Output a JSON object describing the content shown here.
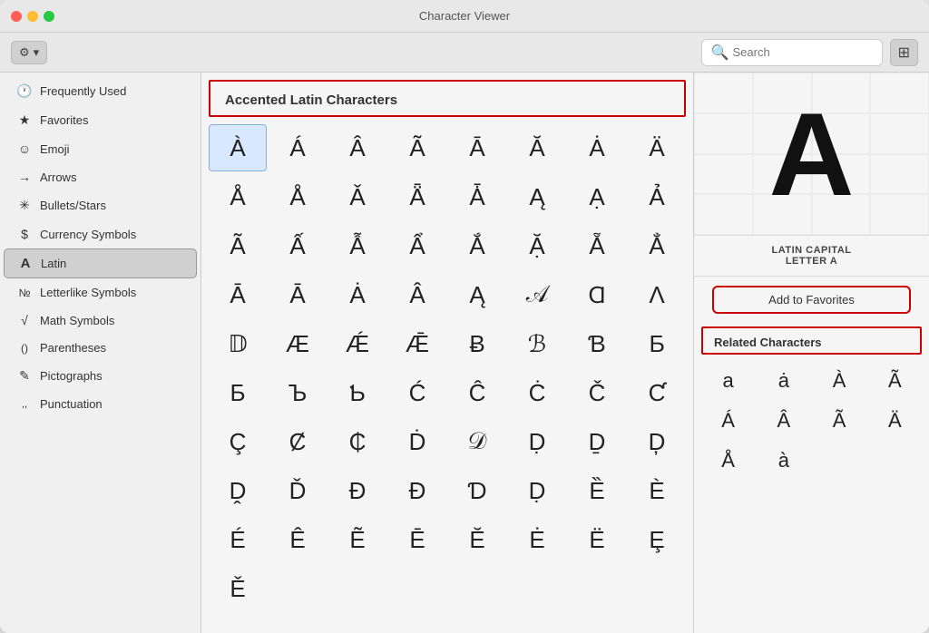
{
  "window": {
    "title": "Character Viewer"
  },
  "toolbar": {
    "gear_label": "⚙",
    "chevron": "▾",
    "search_placeholder": "Search",
    "grid_icon": "⊞"
  },
  "sidebar": {
    "items": [
      {
        "id": "frequently-used",
        "icon": "🕐",
        "label": "Frequently Used"
      },
      {
        "id": "favorites",
        "icon": "★",
        "label": "Favorites"
      },
      {
        "id": "emoji",
        "icon": "☺",
        "label": "Emoji"
      },
      {
        "id": "arrows",
        "icon": "→",
        "label": "Arrows"
      },
      {
        "id": "bullets-stars",
        "icon": "✳",
        "label": "Bullets/Stars"
      },
      {
        "id": "currency-symbols",
        "icon": "$",
        "label": "Currency Symbols"
      },
      {
        "id": "latin",
        "icon": "A",
        "label": "Latin"
      },
      {
        "id": "letterlike-symbols",
        "icon": "№",
        "label": "Letterlike Symbols"
      },
      {
        "id": "math-symbols",
        "icon": "√",
        "label": "Math Symbols"
      },
      {
        "id": "parentheses",
        "icon": "()",
        "label": "Parentheses"
      },
      {
        "id": "pictographs",
        "icon": "✎",
        "label": "Pictographs"
      },
      {
        "id": "punctuation",
        "icon": ",,",
        "label": "Punctuation"
      }
    ]
  },
  "main": {
    "category_header": "Accented Latin Characters",
    "characters": [
      "À",
      "Á",
      "Â",
      "Ã",
      "Ā",
      "Ă",
      "Ȧ",
      "Ä",
      "Å",
      "Å",
      "Ǎ",
      "Ǟ",
      "Ǡ",
      "Ą",
      "Ạ",
      "Ả",
      "Ã",
      "Ấ",
      "Ẫ",
      "Ẩ",
      "Ắ",
      "Ặ",
      "Ẵ",
      "Ẳ",
      "Ā",
      "Ā",
      "Ȧ",
      "Â",
      "Ą",
      "𝒜",
      "Ɑ",
      "Ʌ",
      "𝔻",
      "Æ",
      "Ǽ",
      "Ǣ",
      "Ƀ",
      "ℬ",
      "Ɓ",
      "Ƃ",
      "Б",
      "Ъ",
      "Ƅ",
      "Ć",
      "Ĉ",
      "Ċ",
      "Č",
      "Ƈ",
      "Ç",
      "Ȼ",
      "₵",
      "Ḋ",
      "𝒟",
      "Ḍ",
      "Ḏ",
      "Ḑ",
      "Ḓ",
      "Ď",
      "Đ",
      "Ɖ",
      "Ɗ",
      "Ḍ",
      "Ȅ",
      "È",
      "É",
      "Ê",
      "Ẽ",
      "Ē",
      "Ĕ",
      "Ė",
      "Ë",
      "Ȩ",
      "Ě"
    ]
  },
  "detail": {
    "preview_char": "A",
    "char_name": "LATIN CAPITAL\nLETTER A",
    "add_favorites_label": "Add to Favorites",
    "related_header": "Related Characters",
    "related_chars": [
      "a",
      "ȧ",
      "À",
      "Ã",
      "Á",
      "Â",
      "Ã",
      "Ä",
      "Å",
      "à"
    ]
  }
}
